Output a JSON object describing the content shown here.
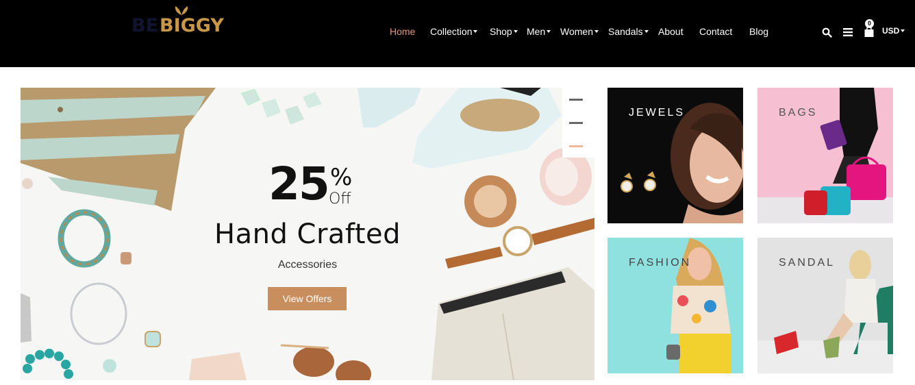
{
  "brand": {
    "logo_prefix": "BE",
    "logo_name": "BIGGY"
  },
  "nav": {
    "items": [
      {
        "label": "Home",
        "active": true,
        "dropdown": false
      },
      {
        "label": "Collection",
        "active": false,
        "dropdown": true
      },
      {
        "label": "Shop",
        "active": false,
        "dropdown": true
      },
      {
        "label": "Men",
        "active": false,
        "dropdown": true
      },
      {
        "label": "Women",
        "active": false,
        "dropdown": true
      },
      {
        "label": "Sandals",
        "active": false,
        "dropdown": true
      },
      {
        "label": "About",
        "active": false,
        "dropdown": false
      },
      {
        "label": "Contact",
        "active": false,
        "dropdown": false
      },
      {
        "label": "Blog",
        "active": false,
        "dropdown": false
      }
    ]
  },
  "header_tools": {
    "search_icon": "search-icon",
    "menu_icon": "hamburger-icon",
    "cart_icon": "shopping-bag-icon",
    "cart_count": "0",
    "currency": "USD"
  },
  "hero": {
    "discount_number": "25",
    "discount_symbol": "%",
    "discount_suffix": "Off",
    "title": "Hand Crafted",
    "subtitle": "Accessories",
    "cta_label": "View Offers",
    "slide_count": 3,
    "active_slide": 3
  },
  "categories": [
    {
      "label": "JEWELS",
      "label_color": "#ffffff"
    },
    {
      "label": "BAGS",
      "label_color": "#555555"
    },
    {
      "label": "FASHION",
      "label_color": "#444444"
    },
    {
      "label": "SANDAL",
      "label_color": "#444444"
    }
  ],
  "colors": {
    "header_bg": "#000000",
    "nav_active": "#e49a7a",
    "cta_bg": "#c98e5e",
    "logo_gold": "#c99846",
    "dot_active": "#f2b79c"
  }
}
